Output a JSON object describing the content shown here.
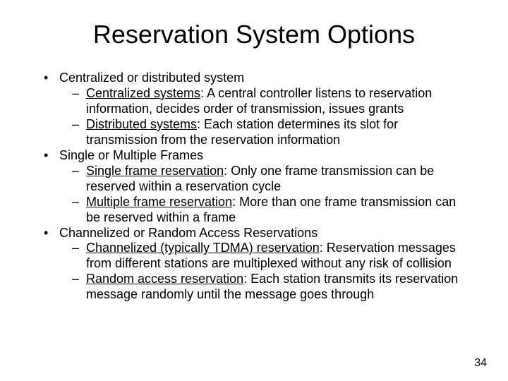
{
  "title": "Reservation System Options",
  "page_number": "34",
  "bullets": [
    {
      "text": "Centralized or distributed system",
      "sub": [
        {
          "term": "Centralized systems",
          "rest": ": A central controller listens to reservation information, decides order of transmission, issues grants"
        },
        {
          "term": "Distributed systems",
          "rest": ": Each station determines its slot for transmission from the reservation information"
        }
      ]
    },
    {
      "text": "Single or Multiple Frames",
      "sub": [
        {
          "term": "Single frame reservation",
          "rest": ": Only one frame transmission can be reserved within a reservation cycle"
        },
        {
          "term": "Multiple frame reservation",
          "rest": ": More than one frame transmission can be reserved within a frame"
        }
      ]
    },
    {
      "text": "Channelized or Random Access Reservations",
      "sub": [
        {
          "term": "Channelized (typically TDMA) reservation",
          "rest": ": Reservation messages from different stations are multiplexed without any risk of collision"
        },
        {
          "term": "Random access reservation",
          "rest": ": Each station transmits its reservation message randomly until the message goes through"
        }
      ]
    }
  ]
}
